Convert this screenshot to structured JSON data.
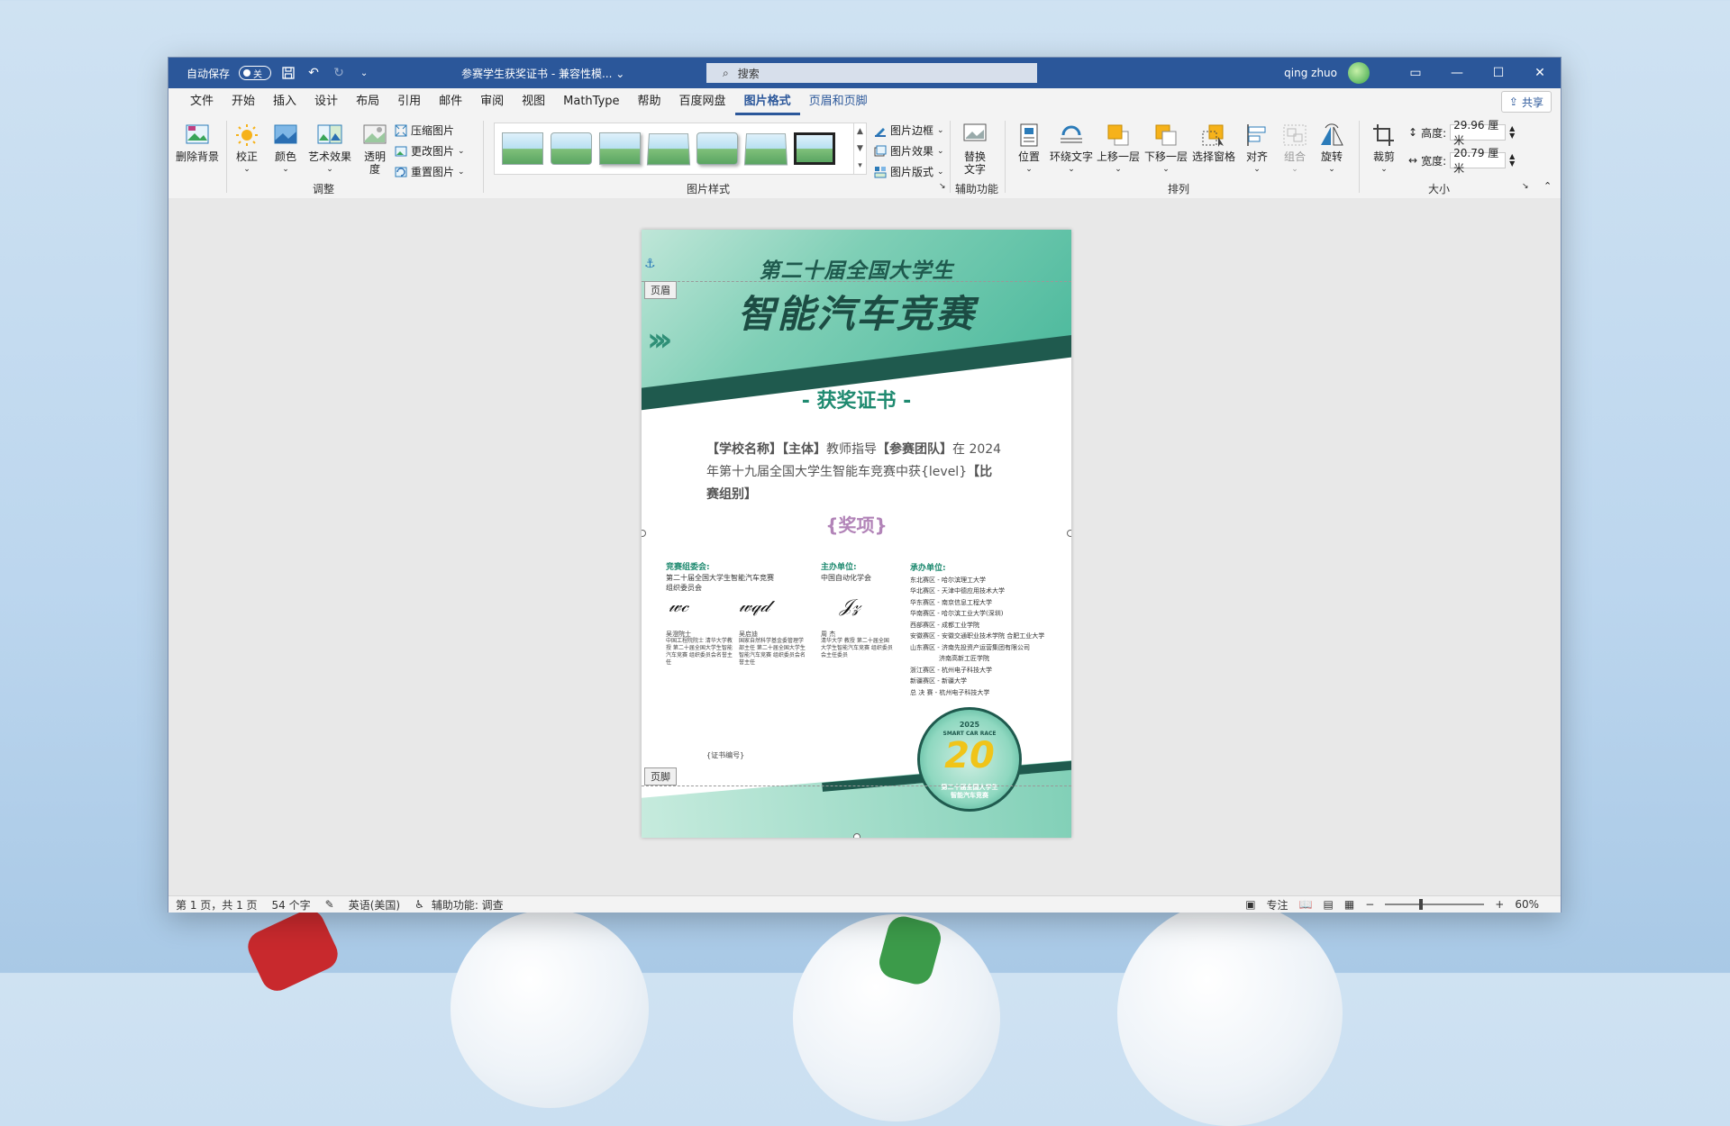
{
  "titlebar": {
    "autosave_label": "自动保存",
    "autosave_state": "关",
    "doc_title": "参赛学生获奖证书  -  兼容性模... ⌄",
    "search_placeholder": "搜索",
    "user_name": "qing zhuo"
  },
  "tabs": [
    "文件",
    "开始",
    "插入",
    "设计",
    "布局",
    "引用",
    "邮件",
    "审阅",
    "视图",
    "MathType",
    "帮助",
    "百度网盘",
    "图片格式",
    "页眉和页脚"
  ],
  "active_tab": "图片格式",
  "share_label": "共享",
  "ribbon": {
    "adjust": {
      "remove_bg": "删除背景",
      "correct": "校正",
      "color": "颜色",
      "artistic": "艺术效果",
      "transparency_1": "透明",
      "transparency_2": "度",
      "compress": "压缩图片",
      "change": "更改图片",
      "reset": "重置图片",
      "group_label": "调整"
    },
    "styles": {
      "border": "图片边框",
      "effects": "图片效果",
      "layout": "图片版式",
      "group_label": "图片样式"
    },
    "accessibility": {
      "alt_text_1": "替换",
      "alt_text_2": "文字",
      "group_label": "辅助功能"
    },
    "arrange": {
      "position": "位置",
      "wrap": "环绕文字",
      "forward": "上移一层",
      "backward": "下移一层",
      "pane": "选择窗格",
      "align": "对齐",
      "group": "组合",
      "rotate": "旋转",
      "group_label": "排列"
    },
    "size": {
      "crop": "裁剪",
      "height_label": "高度:",
      "height_value": "29.96 厘米",
      "width_label": "宽度:",
      "width_value": "20.79 厘米",
      "group_label": "大小"
    }
  },
  "document": {
    "header_tag": "页眉",
    "footer_tag": "页脚",
    "line1": "第二十届全国大学生",
    "line2": "智能汽车竞赛",
    "award_title": "- 获奖证书 -",
    "para_p1": "【学校名称】【主体】",
    "para_p2": "教师指导",
    "para_p3": "【参赛团队】",
    "para_p4": "在 2024 年第十九届全国大学生智能车竞赛中获{level}",
    "para_p5": "【比赛组别】",
    "prize": "{奖项}",
    "committee_head": "竞赛组委会:",
    "committee_1": "第二十届全国大学生智能汽车竞赛",
    "committee_2": "组织委员会",
    "sponsor_head": "主办单位:",
    "sponsor_1": "中国自动化学会",
    "organizer_head": "承办单位:",
    "organizers": [
      "东北赛区 - 哈尔滨理工大学",
      "华北赛区 - 天津中德应用技术大学",
      "华东赛区 - 南京信息工程大学",
      "华南赛区 - 哈尔滨工业大学(深圳)",
      "西部赛区 - 成都工业学院",
      "安徽赛区 - 安徽交通职业技术学院 合肥工业大学",
      "山东赛区 - 济南先投资产运营集团有限公司",
      "济南高新工匠学院",
      "浙江赛区 - 杭州电子科技大学",
      "新疆赛区 - 新疆大学",
      "总 决 赛 - 杭州电子科技大学"
    ],
    "sig_a_name": "吴澄院士",
    "sig_a_desc": "中国工程院院士 清华大学教授 第二十届全国大学生智能汽车竞赛 组织委员会名誉主任",
    "sig_b_name": "吴启迪",
    "sig_b_desc": "国家自然科学基金委管理学部主任 第二十届全国大学生智能汽车竞赛 组织委员会名誉主任",
    "sig_c_name": "周 杰",
    "sig_c_desc": "清华大学 教授 第二十届全国大学生智能汽车竞赛 组织委员会主任委员",
    "badge_year": "2025",
    "badge_sub": "SMART CAR RACE",
    "badge_num": "20",
    "badge_t1": "第二十届全国大学生",
    "badge_t2": "智能汽车竞赛",
    "cert_no": "{证书编号}"
  },
  "status": {
    "page": "第 1 页，共 1 页",
    "words": "54 个字",
    "lang": "英语(美国)",
    "accessibility": "辅助功能: 调查",
    "focus": "专注",
    "zoom": "60%"
  }
}
